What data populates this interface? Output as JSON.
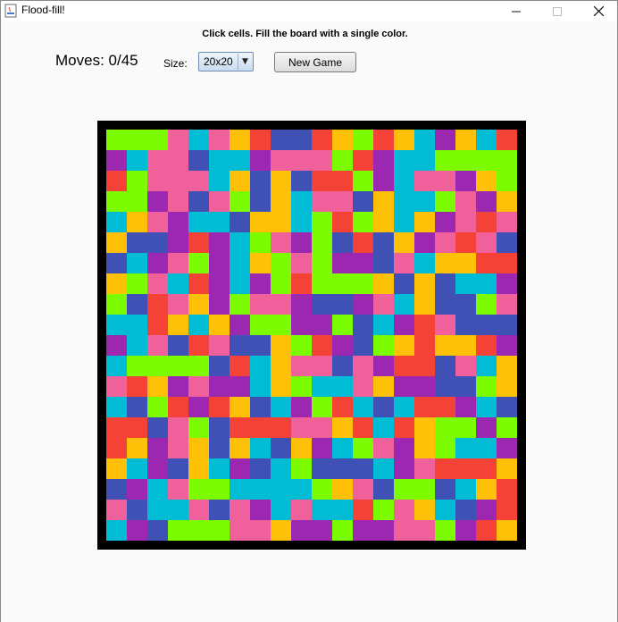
{
  "window": {
    "title": "Flood-fill!"
  },
  "header": {
    "instructions": "Click cells. Fill the board with a single color.",
    "moves_text": "Moves: 0/45",
    "size_label": "Size:",
    "size_selected": "20x20",
    "new_game_label": "New Game"
  },
  "palette": {
    "L": "#7cfc00",
    "P": "#f0609a",
    "Y": "#ffc107",
    "R": "#f44336",
    "B": "#3f51b5",
    "C": "#00bcd4",
    "V": "#9c27b0"
  },
  "board": {
    "rows": 20,
    "cols": 20,
    "grid": [
      "LLLPCPYRBBRYLRYCVYCR",
      "VCPPBCCVPPPLRVCCLLLL",
      "RLPPPCYBYBRRLVCPPVYL",
      "LLVPBPLBYCPPBYCCLPVY",
      "CYPVCCBYYCLRLYCYVPRP",
      "YBBVRVCLPVLBRBYVPRPB",
      "BCVPLVCYLPLVVBPCYYRR",
      "YLPCRVCVLRLLLYBYBCCV",
      "LBRPYVLPPVBBVPCYBBLP",
      "CCRYCYVLLVVLBCVRPBBB",
      "VCPBRPBBYLRVBLYRYYRV",
      "CLLLLBRCYPPBPVRRBPCY",
      "PRYVPVVCYLCCPYVVBBLY",
      "CBLRVRYBCVLRCBCRRVCB",
      "RRBPLBRRRPPYRCRYLLVL",
      "RYVPYBYCBYVCLPVYLCCV",
      "YCVBYCVBCLBBBCVPRRRY",
      "BVCPLLCCCCLYPBLLBCYR",
      "PBCCPBPVCPCCRLPYCBVR",
      "CVBLLLPPYVVLVVPPLVRY"
    ]
  }
}
